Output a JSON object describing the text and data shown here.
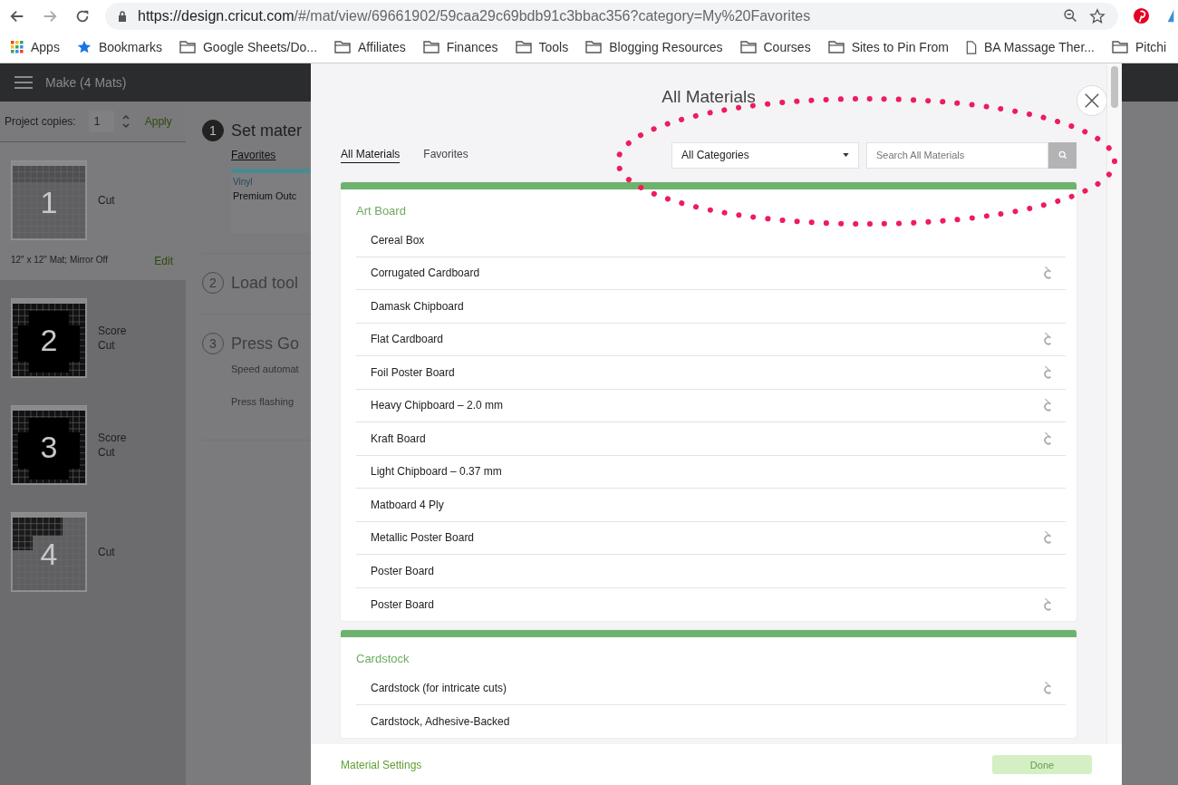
{
  "browser": {
    "url_host": "https://design.cricut.com",
    "url_path": "/#/mat/view/69661902/59caa29c69bdb91c3bbac356?category=My%20Favorites",
    "bookmarks": [
      {
        "kind": "apps",
        "label": "Apps"
      },
      {
        "kind": "star",
        "label": "Bookmarks"
      },
      {
        "kind": "folder",
        "label": "Google Sheets/Do..."
      },
      {
        "kind": "folder",
        "label": "Affiliates"
      },
      {
        "kind": "folder",
        "label": "Finances"
      },
      {
        "kind": "folder",
        "label": "Tools"
      },
      {
        "kind": "folder",
        "label": "Blogging Resources"
      },
      {
        "kind": "folder",
        "label": "Courses"
      },
      {
        "kind": "folder",
        "label": "Sites to Pin From"
      },
      {
        "kind": "page",
        "label": "BA Massage Ther..."
      },
      {
        "kind": "folder",
        "label": "Pitchi"
      }
    ]
  },
  "app_header": {
    "title": "Make (4 Mats)"
  },
  "sidebar": {
    "copies_label": "Project copies:",
    "copies_value": "1",
    "apply": "Apply",
    "mats": [
      {
        "number": "1",
        "kind": "partial",
        "selected": true,
        "operations": [
          "Cut"
        ],
        "info": "12\" x 12\" Mat; Mirror Off",
        "edit": "Edit"
      },
      {
        "number": "2",
        "kind": "full",
        "selected": false,
        "operations": [
          "Score",
          "Cut"
        ]
      },
      {
        "number": "3",
        "kind": "full",
        "selected": false,
        "operations": [
          "Score",
          "Cut"
        ]
      },
      {
        "number": "4",
        "kind": "corner",
        "selected": false,
        "operations": [
          "Cut"
        ]
      }
    ]
  },
  "steps": [
    {
      "number": "1",
      "title": "Set mater",
      "active": true,
      "tab": "Favorites",
      "card": {
        "category": "Vinyl",
        "name": "Premium Outc"
      }
    },
    {
      "number": "2",
      "title": "Load tool",
      "active": false
    },
    {
      "number": "3",
      "title": "Press Go",
      "active": false,
      "notes": [
        "Speed automat",
        "Press flashing"
      ]
    }
  ],
  "modal": {
    "title": "All Materials",
    "tabs": [
      {
        "label": "All Materials",
        "selected": true
      },
      {
        "label": "Favorites",
        "selected": false
      }
    ],
    "category_select": "All Categories",
    "search": {
      "placeholder": "Search All Materials"
    },
    "groups": [
      {
        "name": "Art Board",
        "items": [
          {
            "name": "Cereal Box",
            "blade": false
          },
          {
            "name": "Corrugated Cardboard",
            "blade": true
          },
          {
            "name": "Damask Chipboard",
            "blade": false
          },
          {
            "name": "Flat Cardboard",
            "blade": true
          },
          {
            "name": "Foil Poster Board",
            "blade": true
          },
          {
            "name": "Heavy Chipboard – 2.0 mm",
            "blade": true
          },
          {
            "name": "Kraft Board",
            "blade": true
          },
          {
            "name": "Light Chipboard – 0.37 mm",
            "blade": false
          },
          {
            "name": "Matboard 4 Ply",
            "blade": false
          },
          {
            "name": "Metallic Poster Board",
            "blade": true
          },
          {
            "name": "Poster Board",
            "blade": false
          },
          {
            "name": "Poster Board",
            "blade": true
          }
        ]
      },
      {
        "name": "Cardstock",
        "items": [
          {
            "name": "Cardstock (for intricate cuts)",
            "blade": true
          },
          {
            "name": "Cardstock, Adhesive-Backed",
            "blade": false
          }
        ]
      }
    ],
    "footer_link": "Material Settings",
    "done": {
      "label": "Done",
      "disabled": true
    }
  }
}
